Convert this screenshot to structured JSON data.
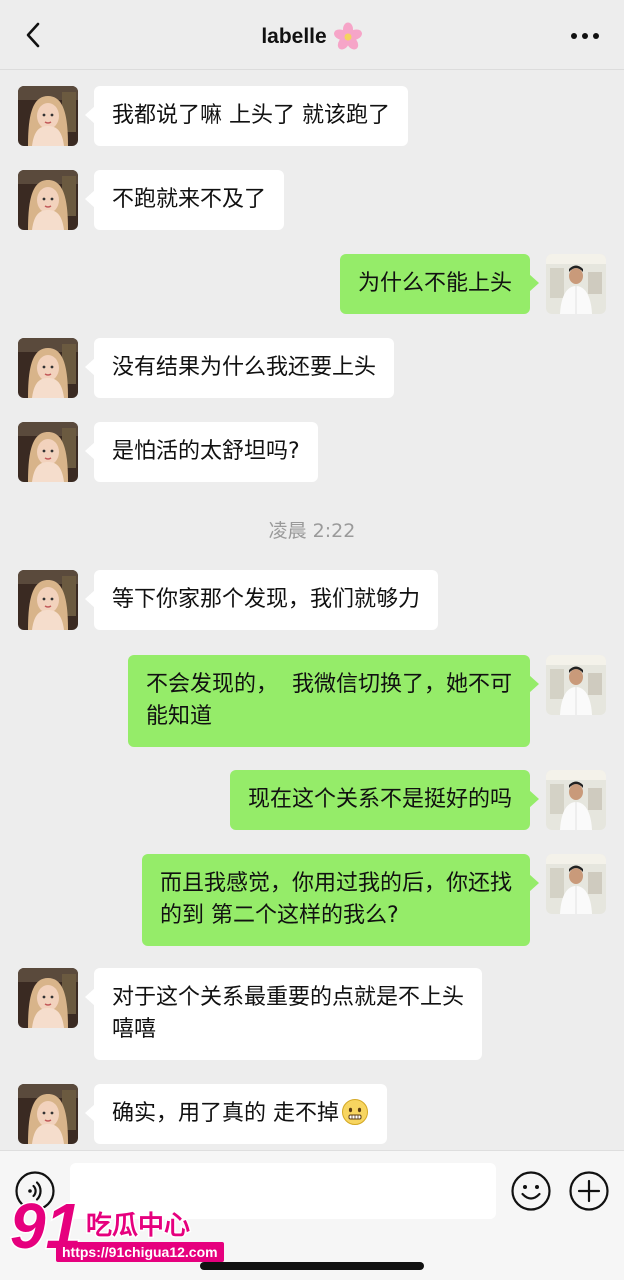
{
  "header": {
    "title": "labelle",
    "title_emoji": "cherry-blossom-icon",
    "back_icon": "chevron-left-icon",
    "more_icon": "more-dots-icon"
  },
  "messages": [
    {
      "side": "in",
      "text": "我都说了嘛 上头了 就该跑了"
    },
    {
      "side": "in",
      "text": "不跑就来不及了"
    },
    {
      "side": "out",
      "text": "为什么不能上头"
    },
    {
      "side": "in",
      "text": "没有结果为什么我还要上头"
    },
    {
      "side": "in",
      "text": "是怕活的太舒坦吗?"
    },
    {
      "side": "in",
      "text": "等下你家那个发现，我们就够力"
    },
    {
      "side": "out",
      "text": "不会发现的，  我微信切换了，她不可\n能知道"
    },
    {
      "side": "out",
      "text": "现在这个关系不是挺好的吗"
    },
    {
      "side": "out",
      "text": "而且我感觉，你用过我的后，你还找\n的到 第二个这样的我么?"
    },
    {
      "side": "in",
      "text": "对于这个关系最重要的点就是不上头\n嘻嘻"
    },
    {
      "side": "in",
      "text": "确实，用了真的 走不掉",
      "emoji": "awkward-smile-emoji"
    }
  ],
  "timestamp": "凌晨 2:22",
  "input_bar": {
    "voice_icon": "voice-icon",
    "emoji_icon": "smiley-icon",
    "plus_icon": "plus-circle-icon",
    "input_value": ""
  },
  "watermark": {
    "logo_text": "91吃瓜中心",
    "url": "https://91chigua12.com"
  },
  "colors": {
    "background": "#ededed",
    "incoming_bubble": "#ffffff",
    "outgoing_bubble": "#95ec69",
    "timestamp": "#9a9a9a",
    "watermark": "#e6007e"
  }
}
